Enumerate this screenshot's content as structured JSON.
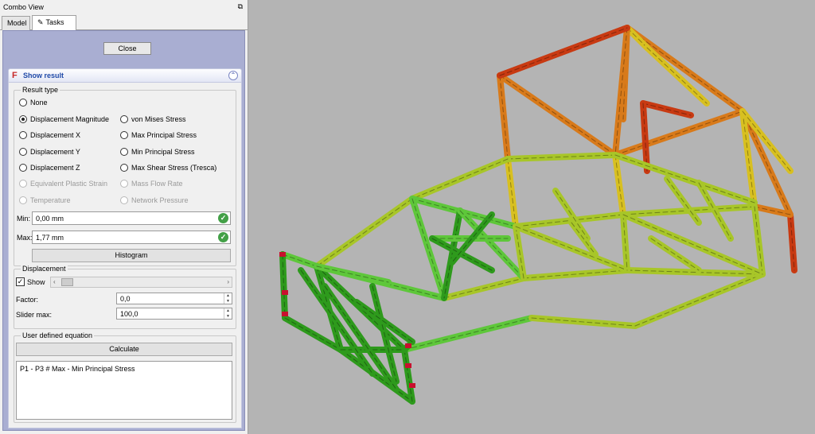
{
  "combo_view": {
    "title": "Combo View",
    "tabs": [
      {
        "label": "Model"
      },
      {
        "label": "Tasks"
      }
    ]
  },
  "tasks": {
    "close_label": "Close",
    "show_result": {
      "title": "Show result",
      "result_type": {
        "group_label": "Result type",
        "options": [
          {
            "label": "None",
            "checked": false,
            "enabled": true
          },
          {
            "label": "Displacement Magnitude",
            "checked": true,
            "enabled": true
          },
          {
            "label": "Displacement X",
            "checked": false,
            "enabled": true
          },
          {
            "label": "Displacement Y",
            "checked": false,
            "enabled": true
          },
          {
            "label": "Displacement Z",
            "checked": false,
            "enabled": true
          },
          {
            "label": "Equivalent Plastic Strain",
            "checked": false,
            "enabled": false
          },
          {
            "label": "Temperature",
            "checked": false,
            "enabled": false
          },
          {
            "label": "von Mises Stress",
            "checked": false,
            "enabled": true
          },
          {
            "label": "Max Principal Stress",
            "checked": false,
            "enabled": true
          },
          {
            "label": "Min Principal Stress",
            "checked": false,
            "enabled": true
          },
          {
            "label": "Max Shear Stress (Tresca)",
            "checked": false,
            "enabled": true
          },
          {
            "label": "Mass Flow Rate",
            "checked": false,
            "enabled": false
          },
          {
            "label": "Network Pressure",
            "checked": false,
            "enabled": false
          }
        ],
        "min_label": "Min:",
        "min_value": "0,00 mm",
        "max_label": "Max:",
        "max_value": "1,77 mm",
        "histogram_label": "Histogram"
      },
      "displacement": {
        "group_label": "Displacement",
        "show_label": "Show",
        "show_checked": true,
        "factor_label": "Factor:",
        "factor_value": "0,0",
        "slider_max_label": "Slider max:",
        "slider_max_value": "100,0"
      },
      "equation": {
        "group_label": "User defined equation",
        "calculate_label": "Calculate",
        "text": "P1 - P3 # Max - Min Principal Stress"
      }
    }
  },
  "viewport": {
    "background": "#b4b4b4",
    "colors": {
      "low": "#2e9a1c",
      "low_light": "#5ec73a",
      "mid": "#a8c628",
      "high": "#d8c020",
      "higher": "#d87a1a",
      "max": "#c83a12"
    }
  }
}
